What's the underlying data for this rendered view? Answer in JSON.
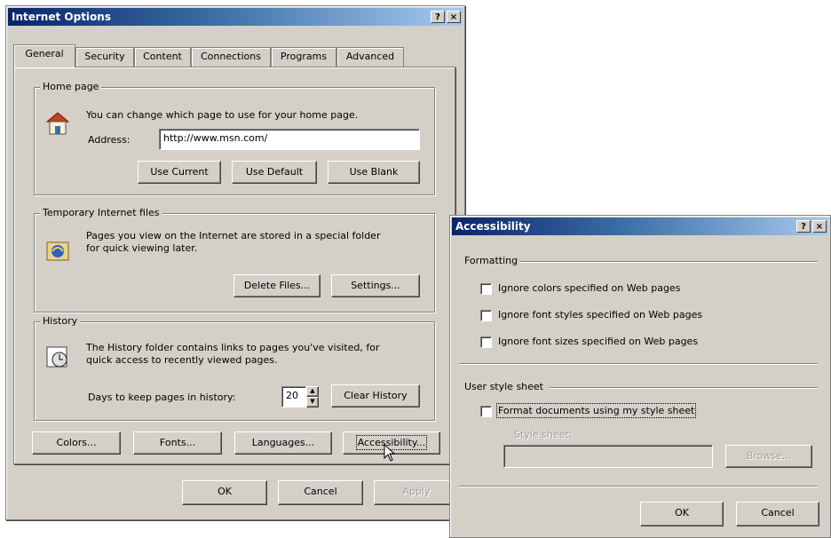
{
  "internet_options": {
    "title": "Internet Options",
    "title_help": "?",
    "title_close": "×",
    "tabs": [
      {
        "label": "General"
      },
      {
        "label": "Security"
      },
      {
        "label": "Content"
      },
      {
        "label": "Connections"
      },
      {
        "label": "Programs"
      },
      {
        "label": "Advanced"
      }
    ],
    "home_page": {
      "legend": "Home page",
      "description": "You can change which page to use for your home page.",
      "address_label": "Address:",
      "address_value": "http://www.msn.com/",
      "use_current": "Use Current",
      "use_default": "Use Default",
      "use_blank": "Use Blank"
    },
    "temp_files": {
      "legend": "Temporary Internet files",
      "description_line1": "Pages you view on the Internet are stored in a special folder",
      "description_line2": "for quick viewing later.",
      "delete_files": "Delete Files...",
      "settings": "Settings..."
    },
    "history": {
      "legend": "History",
      "description_line1": "The History folder contains links to pages you've visited, for",
      "description_line2": "quick access to recently viewed pages.",
      "days_label": "Days to keep pages in history:",
      "days_value": "20",
      "clear_history": "Clear History"
    },
    "bottom_buttons": {
      "colors": "Colors...",
      "fonts": "Fonts...",
      "languages": "Languages...",
      "accessibility": "Accessibility..."
    },
    "dialog_buttons": {
      "ok": "OK",
      "cancel": "Cancel",
      "apply": "Apply"
    }
  },
  "accessibility": {
    "title": "Accessibility",
    "title_help": "?",
    "title_close": "×",
    "formatting": {
      "legend": "Formatting",
      "ignore_colors": "Ignore colors specified on Web pages",
      "ignore_font_styles": "Ignore font styles specified on Web pages",
      "ignore_font_sizes": "Ignore font sizes specified on Web pages"
    },
    "user_style_sheet": {
      "legend": "User style sheet",
      "format_documents": "Format documents using my style sheet",
      "style_sheet_label": "Style sheet:",
      "browse": "Browse..."
    },
    "ok": "OK",
    "cancel": "Cancel"
  }
}
